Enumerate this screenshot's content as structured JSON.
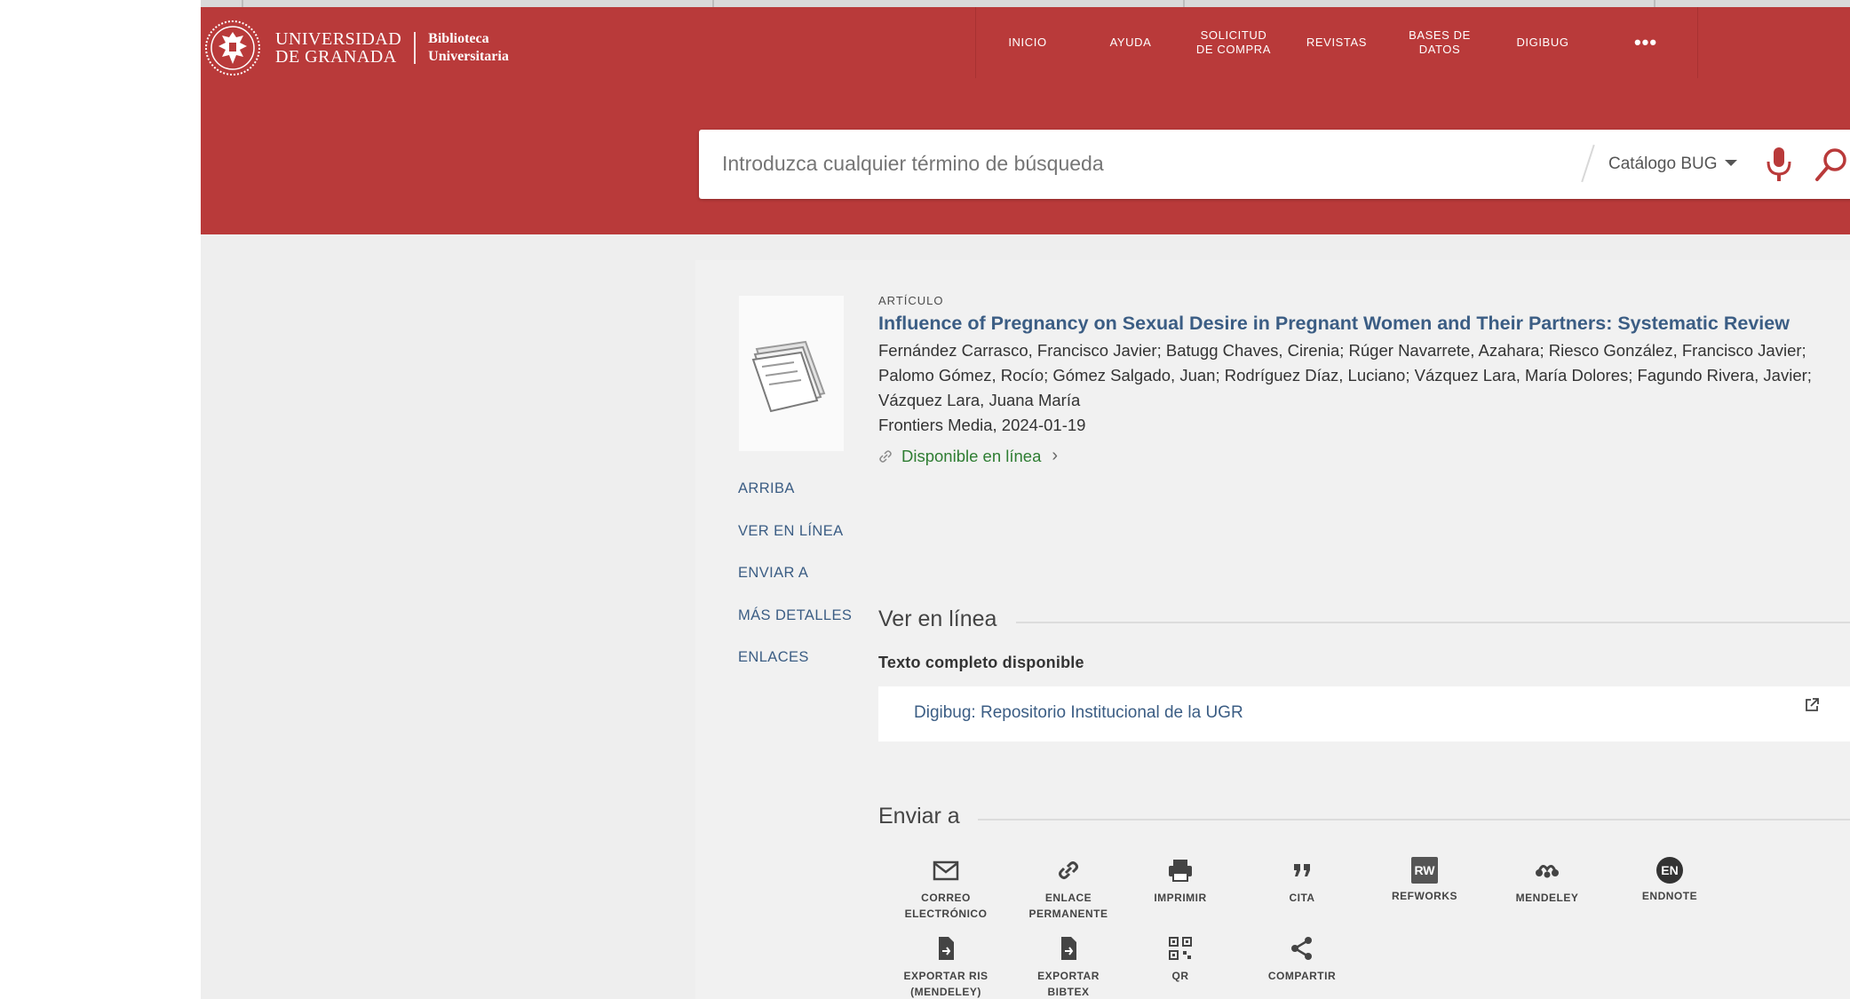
{
  "header": {
    "logo": {
      "line1": "UNIVERSIDAD",
      "line2": "DE GRANADA",
      "sub1": "Biblioteca",
      "sub2": "Universitaria"
    },
    "nav": [
      {
        "label": "INICIO"
      },
      {
        "label": "AYUDA"
      },
      {
        "label": "SOLICITUD DE COMPRA"
      },
      {
        "label": "REVISTAS"
      },
      {
        "label": "BASES DE DATOS"
      },
      {
        "label": "DIGIBUG"
      },
      {
        "label": "•••"
      }
    ]
  },
  "search": {
    "placeholder": "Introduzca cualquier término de búsqueda",
    "scope": "Catálogo BUG"
  },
  "record": {
    "type": "ARTÍCULO",
    "title": "Influence of Pregnancy on Sexual Desire in Pregnant Women and Their Partners: Systematic Review",
    "authors": "Fernández Carrasco, Francisco Javier; Batugg Chaves, Cirenia; Rúger Navarrete, Azahara; Riesco González, Francisco Javier; Palomo Gómez, Rocío; Gómez Salgado, Juan; Rodríguez Díaz, Luciano; Vázquez Lara, María Dolores; Fagundo Rivera, Javier; Vázquez Lara, Juana María",
    "publisher": "Frontiers Media, 2024-01-19",
    "availability": "Disponible en línea"
  },
  "sidenav": [
    "ARRIBA",
    "VER EN LÍNEA",
    "ENVIAR A",
    "MÁS DETALLES",
    "ENLACES"
  ],
  "online": {
    "title": "Ver en línea",
    "subhead": "Texto completo disponible",
    "repository": "Digibug: Repositorio Institucional de la UGR"
  },
  "send": {
    "title": "Enviar a",
    "actions": [
      {
        "label1": "CORREO",
        "label2": "ELECTRÓNICO",
        "icon": "mail-icon"
      },
      {
        "label1": "ENLACE",
        "label2": "PERMANENTE",
        "icon": "link-icon"
      },
      {
        "label1": "IMPRIMIR",
        "label2": "",
        "icon": "print-icon"
      },
      {
        "label1": "CITA",
        "label2": "",
        "icon": "quote-icon"
      },
      {
        "label1": "REFWORKS",
        "label2": "",
        "icon": "refworks-icon",
        "badge": "RW"
      },
      {
        "label1": "MENDELEY",
        "label2": "",
        "icon": "mendeley-icon"
      },
      {
        "label1": "ENDNOTE",
        "label2": "",
        "icon": "endnote-icon",
        "badge": "EN"
      },
      {
        "label1": "EXPORTAR RIS",
        "label2": "(MENDELEY)",
        "icon": "export-file-icon"
      },
      {
        "label1": "EXPORTAR",
        "label2": "BIBTEX",
        "icon": "export-file-icon"
      },
      {
        "label1": "QR",
        "label2": "",
        "icon": "qr-icon"
      },
      {
        "label1": "COMPARTIR",
        "label2": "",
        "icon": "share-icon"
      }
    ]
  },
  "colors": {
    "brand": "#b93a3a",
    "link": "#3b5d84",
    "available": "#2e7d32"
  }
}
